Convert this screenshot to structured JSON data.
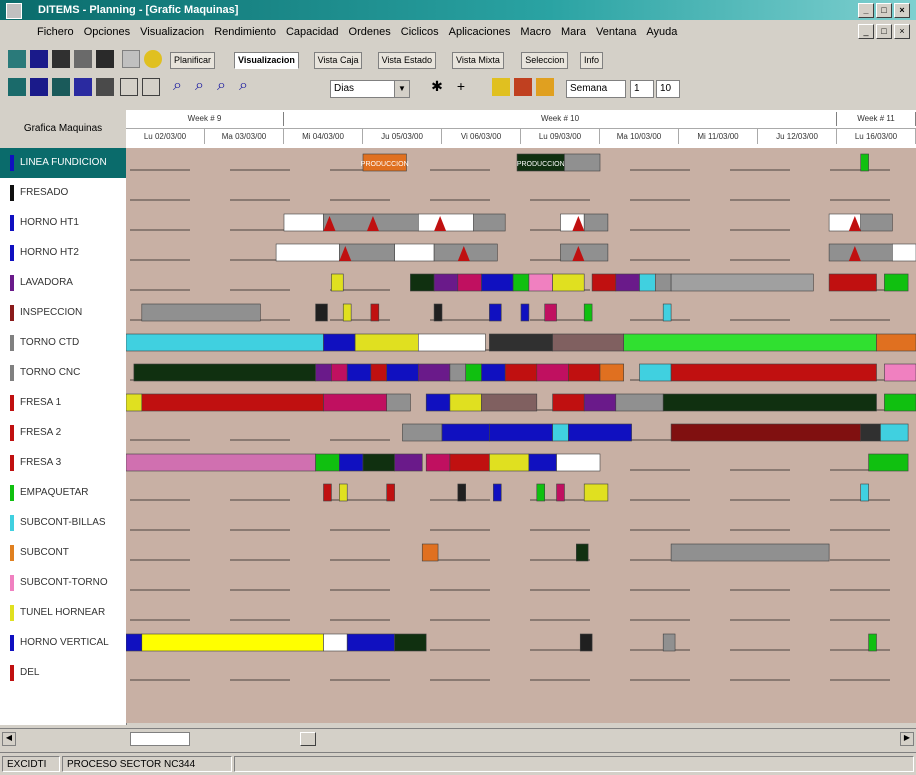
{
  "window": {
    "title": "DITEMS - Planning - [Grafic Maquinas]"
  },
  "menu": [
    "Fichero",
    "Opciones",
    "Visualizacion",
    "Rendimiento",
    "Capacidad",
    "Ordenes",
    "Ciclicos",
    "Aplicaciones",
    "Macro",
    "Mara",
    "Ventana",
    "Ayuda"
  ],
  "views": {
    "labels": [
      "Planificar",
      "Visualizacion",
      "Vista Caja",
      "Vista Estado",
      "Vista Mixta",
      "Seleccion",
      "Info"
    ],
    "active_index": 1
  },
  "toolbar": {
    "zoom_value": "Dias",
    "date_label": "Semana",
    "date_value": "1",
    "date_value2": "10"
  },
  "left_header": "Grafica Maquinas",
  "resources": [
    {
      "name": "LINEA FUNDICION",
      "color": "#1010c0",
      "selected": true
    },
    {
      "name": "FRESADO",
      "color": "#101010"
    },
    {
      "name": "HORNO HT1",
      "color": "#1010c0"
    },
    {
      "name": "HORNO HT2",
      "color": "#1010c0"
    },
    {
      "name": "LAVADORA",
      "color": "#6a1a8a"
    },
    {
      "name": "INSPECCION",
      "color": "#8a1a1a"
    },
    {
      "name": "TORNO CTD",
      "color": "#808080"
    },
    {
      "name": "TORNO CNC",
      "color": "#808080"
    },
    {
      "name": "FRESA 1",
      "color": "#c01010"
    },
    {
      "name": "FRESA 2",
      "color": "#c01010"
    },
    {
      "name": "FRESA 3",
      "color": "#c01010"
    },
    {
      "name": "EMPAQUETAR",
      "color": "#10c010"
    },
    {
      "name": "SUBCONT-BILLAS",
      "color": "#40d0e0"
    },
    {
      "name": "SUBCONT",
      "color": "#e08020"
    },
    {
      "name": "SUBCONT-TORNO",
      "color": "#f080c0"
    },
    {
      "name": "TUNEL HORNEAR",
      "color": "#e0e020"
    },
    {
      "name": "HORNO VERTICAL",
      "color": "#1010c0"
    },
    {
      "name": "DEL",
      "color": "#c01010"
    }
  ],
  "weeks": [
    {
      "label": "Week # 9",
      "span": 2
    },
    {
      "label": "Week # 10",
      "span": 7
    },
    {
      "label": "Week # 11",
      "span": 1
    }
  ],
  "days": [
    "Lu 02/03/00",
    "Ma 03/03/00",
    "Mi 04/03/00",
    "Ju 05/03/00",
    "Vi 06/03/00",
    "Lu 09/03/00",
    "Ma 10/03/00",
    "Mi 11/03/00",
    "Ju 12/03/00",
    "Lu 16/03/00"
  ],
  "bars": [
    {
      "row": 0,
      "start": 0.3,
      "end": 0.355,
      "color": "#e07020",
      "label": "PRODUCCION"
    },
    {
      "row": 0,
      "start": 0.495,
      "end": 0.555,
      "color": "#103010",
      "label": "PRODUCCION"
    },
    {
      "row": 0,
      "start": 0.555,
      "end": 0.6,
      "color": "#909090",
      "label": ""
    },
    {
      "row": 0,
      "start": 0.93,
      "end": 0.94,
      "color": "#10c010",
      "label": ""
    },
    {
      "row": 2,
      "start": 0.2,
      "end": 0.25,
      "color": "#ffffff",
      "label": ""
    },
    {
      "row": 2,
      "start": 0.25,
      "end": 0.37,
      "color": "#909090",
      "label": ""
    },
    {
      "row": 2,
      "start": 0.37,
      "end": 0.44,
      "color": "#ffffff",
      "label": ""
    },
    {
      "row": 2,
      "start": 0.44,
      "end": 0.48,
      "color": "#909090",
      "label": ""
    },
    {
      "row": 2,
      "start": 0.55,
      "end": 0.58,
      "color": "#ffffff",
      "label": ""
    },
    {
      "row": 2,
      "start": 0.58,
      "end": 0.61,
      "color": "#909090",
      "label": ""
    },
    {
      "row": 2,
      "start": 0.89,
      "end": 0.93,
      "color": "#ffffff",
      "label": ""
    },
    {
      "row": 2,
      "start": 0.93,
      "end": 0.97,
      "color": "#909090",
      "label": ""
    },
    {
      "row": 3,
      "start": 0.19,
      "end": 0.27,
      "color": "#ffffff",
      "label": ""
    },
    {
      "row": 3,
      "start": 0.27,
      "end": 0.34,
      "color": "#909090",
      "label": ""
    },
    {
      "row": 3,
      "start": 0.34,
      "end": 0.39,
      "color": "#ffffff",
      "label": ""
    },
    {
      "row": 3,
      "start": 0.39,
      "end": 0.47,
      "color": "#909090",
      "label": ""
    },
    {
      "row": 3,
      "start": 0.55,
      "end": 0.61,
      "color": "#909090",
      "label": ""
    },
    {
      "row": 3,
      "start": 0.89,
      "end": 0.97,
      "color": "#909090",
      "label": ""
    },
    {
      "row": 3,
      "start": 0.97,
      "end": 1.0,
      "color": "#ffffff",
      "label": ""
    },
    {
      "row": 4,
      "start": 0.26,
      "end": 0.275,
      "color": "#e0e020",
      "label": ""
    },
    {
      "row": 4,
      "start": 0.36,
      "end": 0.39,
      "color": "#103010",
      "label": ""
    },
    {
      "row": 4,
      "start": 0.39,
      "end": 0.42,
      "color": "#6a1a8a",
      "label": ""
    },
    {
      "row": 4,
      "start": 0.42,
      "end": 0.45,
      "color": "#c01060",
      "label": ""
    },
    {
      "row": 4,
      "start": 0.45,
      "end": 0.49,
      "color": "#1010c0",
      "label": ""
    },
    {
      "row": 4,
      "start": 0.49,
      "end": 0.51,
      "color": "#10c010",
      "label": ""
    },
    {
      "row": 4,
      "start": 0.51,
      "end": 0.54,
      "color": "#f080c0",
      "label": ""
    },
    {
      "row": 4,
      "start": 0.54,
      "end": 0.58,
      "color": "#e0e020",
      "label": ""
    },
    {
      "row": 4,
      "start": 0.59,
      "end": 0.62,
      "color": "#c01010",
      "label": ""
    },
    {
      "row": 4,
      "start": 0.62,
      "end": 0.65,
      "color": "#6a1a8a",
      "label": ""
    },
    {
      "row": 4,
      "start": 0.65,
      "end": 0.67,
      "color": "#40d0e0",
      "label": ""
    },
    {
      "row": 4,
      "start": 0.67,
      "end": 0.69,
      "color": "#909090",
      "label": ""
    },
    {
      "row": 4,
      "start": 0.69,
      "end": 0.87,
      "color": "#a0a0a0",
      "label": ""
    },
    {
      "row": 4,
      "start": 0.89,
      "end": 0.95,
      "color": "#c01010",
      "label": ""
    },
    {
      "row": 4,
      "start": 0.96,
      "end": 0.99,
      "color": "#10c010",
      "label": ""
    },
    {
      "row": 5,
      "start": 0.02,
      "end": 0.17,
      "color": "#909090",
      "label": ""
    },
    {
      "row": 5,
      "start": 0.24,
      "end": 0.255,
      "color": "#202020",
      "label": ""
    },
    {
      "row": 5,
      "start": 0.275,
      "end": 0.285,
      "color": "#e0e020",
      "label": ""
    },
    {
      "row": 5,
      "start": 0.31,
      "end": 0.32,
      "color": "#c01010",
      "label": ""
    },
    {
      "row": 5,
      "start": 0.39,
      "end": 0.4,
      "color": "#202020",
      "label": ""
    },
    {
      "row": 5,
      "start": 0.46,
      "end": 0.475,
      "color": "#1010c0",
      "label": ""
    },
    {
      "row": 5,
      "start": 0.5,
      "end": 0.51,
      "color": "#1010c0",
      "label": ""
    },
    {
      "row": 5,
      "start": 0.53,
      "end": 0.545,
      "color": "#c01060",
      "label": ""
    },
    {
      "row": 5,
      "start": 0.58,
      "end": 0.59,
      "color": "#10c010",
      "label": ""
    },
    {
      "row": 5,
      "start": 0.68,
      "end": 0.69,
      "color": "#40d0e0",
      "label": ""
    },
    {
      "row": 6,
      "start": 0.0,
      "end": 0.25,
      "color": "#40d0e0",
      "label": ""
    },
    {
      "row": 6,
      "start": 0.25,
      "end": 0.29,
      "color": "#1010c0",
      "label": ""
    },
    {
      "row": 6,
      "start": 0.29,
      "end": 0.37,
      "color": "#e0e020",
      "label": ""
    },
    {
      "row": 6,
      "start": 0.37,
      "end": 0.455,
      "color": "#ffffff",
      "label": ""
    },
    {
      "row": 6,
      "start": 0.46,
      "end": 0.54,
      "color": "#303030",
      "label": ""
    },
    {
      "row": 6,
      "start": 0.54,
      "end": 0.63,
      "color": "#806060",
      "label": ""
    },
    {
      "row": 6,
      "start": 0.63,
      "end": 0.95,
      "color": "#30e030",
      "label": ""
    },
    {
      "row": 6,
      "start": 0.95,
      "end": 1.0,
      "color": "#e07020",
      "label": ""
    },
    {
      "row": 7,
      "start": 0.01,
      "end": 0.24,
      "color": "#103010",
      "label": ""
    },
    {
      "row": 7,
      "start": 0.24,
      "end": 0.26,
      "color": "#6a1a8a",
      "label": ""
    },
    {
      "row": 7,
      "start": 0.26,
      "end": 0.28,
      "color": "#c01060",
      "label": ""
    },
    {
      "row": 7,
      "start": 0.28,
      "end": 0.31,
      "color": "#1010c0",
      "label": ""
    },
    {
      "row": 7,
      "start": 0.31,
      "end": 0.33,
      "color": "#c01010",
      "label": ""
    },
    {
      "row": 7,
      "start": 0.33,
      "end": 0.37,
      "color": "#1010c0",
      "label": ""
    },
    {
      "row": 7,
      "start": 0.37,
      "end": 0.41,
      "color": "#6a1a8a",
      "label": ""
    },
    {
      "row": 7,
      "start": 0.41,
      "end": 0.43,
      "color": "#909090",
      "label": ""
    },
    {
      "row": 7,
      "start": 0.43,
      "end": 0.45,
      "color": "#10c010",
      "label": ""
    },
    {
      "row": 7,
      "start": 0.45,
      "end": 0.48,
      "color": "#1010c0",
      "label": ""
    },
    {
      "row": 7,
      "start": 0.48,
      "end": 0.52,
      "color": "#c01010",
      "label": ""
    },
    {
      "row": 7,
      "start": 0.52,
      "end": 0.56,
      "color": "#c01060",
      "label": ""
    },
    {
      "row": 7,
      "start": 0.56,
      "end": 0.6,
      "color": "#c01010",
      "label": ""
    },
    {
      "row": 7,
      "start": 0.6,
      "end": 0.63,
      "color": "#e07020",
      "label": ""
    },
    {
      "row": 7,
      "start": 0.65,
      "end": 0.69,
      "color": "#40d0e0",
      "label": ""
    },
    {
      "row": 7,
      "start": 0.69,
      "end": 0.95,
      "color": "#c01010",
      "label": ""
    },
    {
      "row": 7,
      "start": 0.96,
      "end": 1.0,
      "color": "#f080c0",
      "label": ""
    },
    {
      "row": 8,
      "start": 0.0,
      "end": 0.02,
      "color": "#e0e020",
      "label": ""
    },
    {
      "row": 8,
      "start": 0.02,
      "end": 0.25,
      "color": "#c01010",
      "label": ""
    },
    {
      "row": 8,
      "start": 0.25,
      "end": 0.33,
      "color": "#c01060",
      "label": ""
    },
    {
      "row": 8,
      "start": 0.33,
      "end": 0.36,
      "color": "#909090",
      "label": ""
    },
    {
      "row": 8,
      "start": 0.38,
      "end": 0.41,
      "color": "#1010c0",
      "label": ""
    },
    {
      "row": 8,
      "start": 0.41,
      "end": 0.45,
      "color": "#e0e020",
      "label": ""
    },
    {
      "row": 8,
      "start": 0.45,
      "end": 0.52,
      "color": "#806060",
      "label": ""
    },
    {
      "row": 8,
      "start": 0.54,
      "end": 0.58,
      "color": "#c01010",
      "label": ""
    },
    {
      "row": 8,
      "start": 0.58,
      "end": 0.62,
      "color": "#6a1a8a",
      "label": ""
    },
    {
      "row": 8,
      "start": 0.62,
      "end": 0.68,
      "color": "#909090",
      "label": ""
    },
    {
      "row": 8,
      "start": 0.68,
      "end": 0.95,
      "color": "#103010",
      "label": ""
    },
    {
      "row": 8,
      "start": 0.96,
      "end": 1.0,
      "color": "#10c010",
      "label": ""
    },
    {
      "row": 9,
      "start": 0.35,
      "end": 0.4,
      "color": "#909090",
      "label": ""
    },
    {
      "row": 9,
      "start": 0.4,
      "end": 0.46,
      "color": "#1010c0",
      "label": ""
    },
    {
      "row": 9,
      "start": 0.46,
      "end": 0.54,
      "color": "#1010c0",
      "label": ""
    },
    {
      "row": 9,
      "start": 0.54,
      "end": 0.56,
      "color": "#40d0e0",
      "label": ""
    },
    {
      "row": 9,
      "start": 0.56,
      "end": 0.64,
      "color": "#1010c0",
      "label": ""
    },
    {
      "row": 9,
      "start": 0.69,
      "end": 0.93,
      "color": "#801010",
      "label": ""
    },
    {
      "row": 9,
      "start": 0.93,
      "end": 0.955,
      "color": "#303030",
      "label": ""
    },
    {
      "row": 9,
      "start": 0.955,
      "end": 0.99,
      "color": "#40d0e0",
      "label": ""
    },
    {
      "row": 10,
      "start": 0.0,
      "end": 0.24,
      "color": "#d070b0",
      "label": ""
    },
    {
      "row": 10,
      "start": 0.24,
      "end": 0.27,
      "color": "#10c010",
      "label": ""
    },
    {
      "row": 10,
      "start": 0.27,
      "end": 0.3,
      "color": "#1010c0",
      "label": ""
    },
    {
      "row": 10,
      "start": 0.3,
      "end": 0.34,
      "color": "#103010",
      "label": ""
    },
    {
      "row": 10,
      "start": 0.34,
      "end": 0.375,
      "color": "#6a1a8a",
      "label": ""
    },
    {
      "row": 10,
      "start": 0.38,
      "end": 0.41,
      "color": "#c01060",
      "label": ""
    },
    {
      "row": 10,
      "start": 0.41,
      "end": 0.46,
      "color": "#c01010",
      "label": ""
    },
    {
      "row": 10,
      "start": 0.46,
      "end": 0.51,
      "color": "#e0e020",
      "label": ""
    },
    {
      "row": 10,
      "start": 0.51,
      "end": 0.545,
      "color": "#1010c0",
      "label": ""
    },
    {
      "row": 10,
      "start": 0.545,
      "end": 0.6,
      "color": "#ffffff",
      "label": ""
    },
    {
      "row": 10,
      "start": 0.94,
      "end": 0.99,
      "color": "#10c010",
      "label": ""
    },
    {
      "row": 11,
      "start": 0.25,
      "end": 0.26,
      "color": "#c01010",
      "label": ""
    },
    {
      "row": 11,
      "start": 0.27,
      "end": 0.28,
      "color": "#e0e020",
      "label": ""
    },
    {
      "row": 11,
      "start": 0.33,
      "end": 0.34,
      "color": "#c01010",
      "label": ""
    },
    {
      "row": 11,
      "start": 0.42,
      "end": 0.43,
      "color": "#202020",
      "label": ""
    },
    {
      "row": 11,
      "start": 0.465,
      "end": 0.475,
      "color": "#1010c0",
      "label": ""
    },
    {
      "row": 11,
      "start": 0.52,
      "end": 0.53,
      "color": "#10c010",
      "label": ""
    },
    {
      "row": 11,
      "start": 0.545,
      "end": 0.555,
      "color": "#c01060",
      "label": ""
    },
    {
      "row": 11,
      "start": 0.58,
      "end": 0.61,
      "color": "#e0e020",
      "label": ""
    },
    {
      "row": 11,
      "start": 0.93,
      "end": 0.94,
      "color": "#40d0e0",
      "label": ""
    },
    {
      "row": 13,
      "start": 0.375,
      "end": 0.395,
      "color": "#e07020",
      "label": ""
    },
    {
      "row": 13,
      "start": 0.57,
      "end": 0.585,
      "color": "#103010",
      "label": ""
    },
    {
      "row": 13,
      "start": 0.69,
      "end": 0.89,
      "color": "#909090",
      "label": ""
    },
    {
      "row": 16,
      "start": 0.0,
      "end": 0.02,
      "color": "#1010c0",
      "label": ""
    },
    {
      "row": 16,
      "start": 0.02,
      "end": 0.25,
      "color": "#ffff00",
      "label": ""
    },
    {
      "row": 16,
      "start": 0.25,
      "end": 0.28,
      "color": "#ffffff",
      "label": ""
    },
    {
      "row": 16,
      "start": 0.28,
      "end": 0.34,
      "color": "#1010c0",
      "label": ""
    },
    {
      "row": 16,
      "start": 0.34,
      "end": 0.38,
      "color": "#103010",
      "label": ""
    },
    {
      "row": 16,
      "start": 0.575,
      "end": 0.59,
      "color": "#202020",
      "label": ""
    },
    {
      "row": 16,
      "start": 0.68,
      "end": 0.695,
      "color": "#909090",
      "label": ""
    },
    {
      "row": 16,
      "start": 0.94,
      "end": 0.95,
      "color": "#10c010",
      "label": ""
    }
  ],
  "status": {
    "left": "EXCIDTI",
    "middle": "PROCESO SECTOR NC344"
  }
}
